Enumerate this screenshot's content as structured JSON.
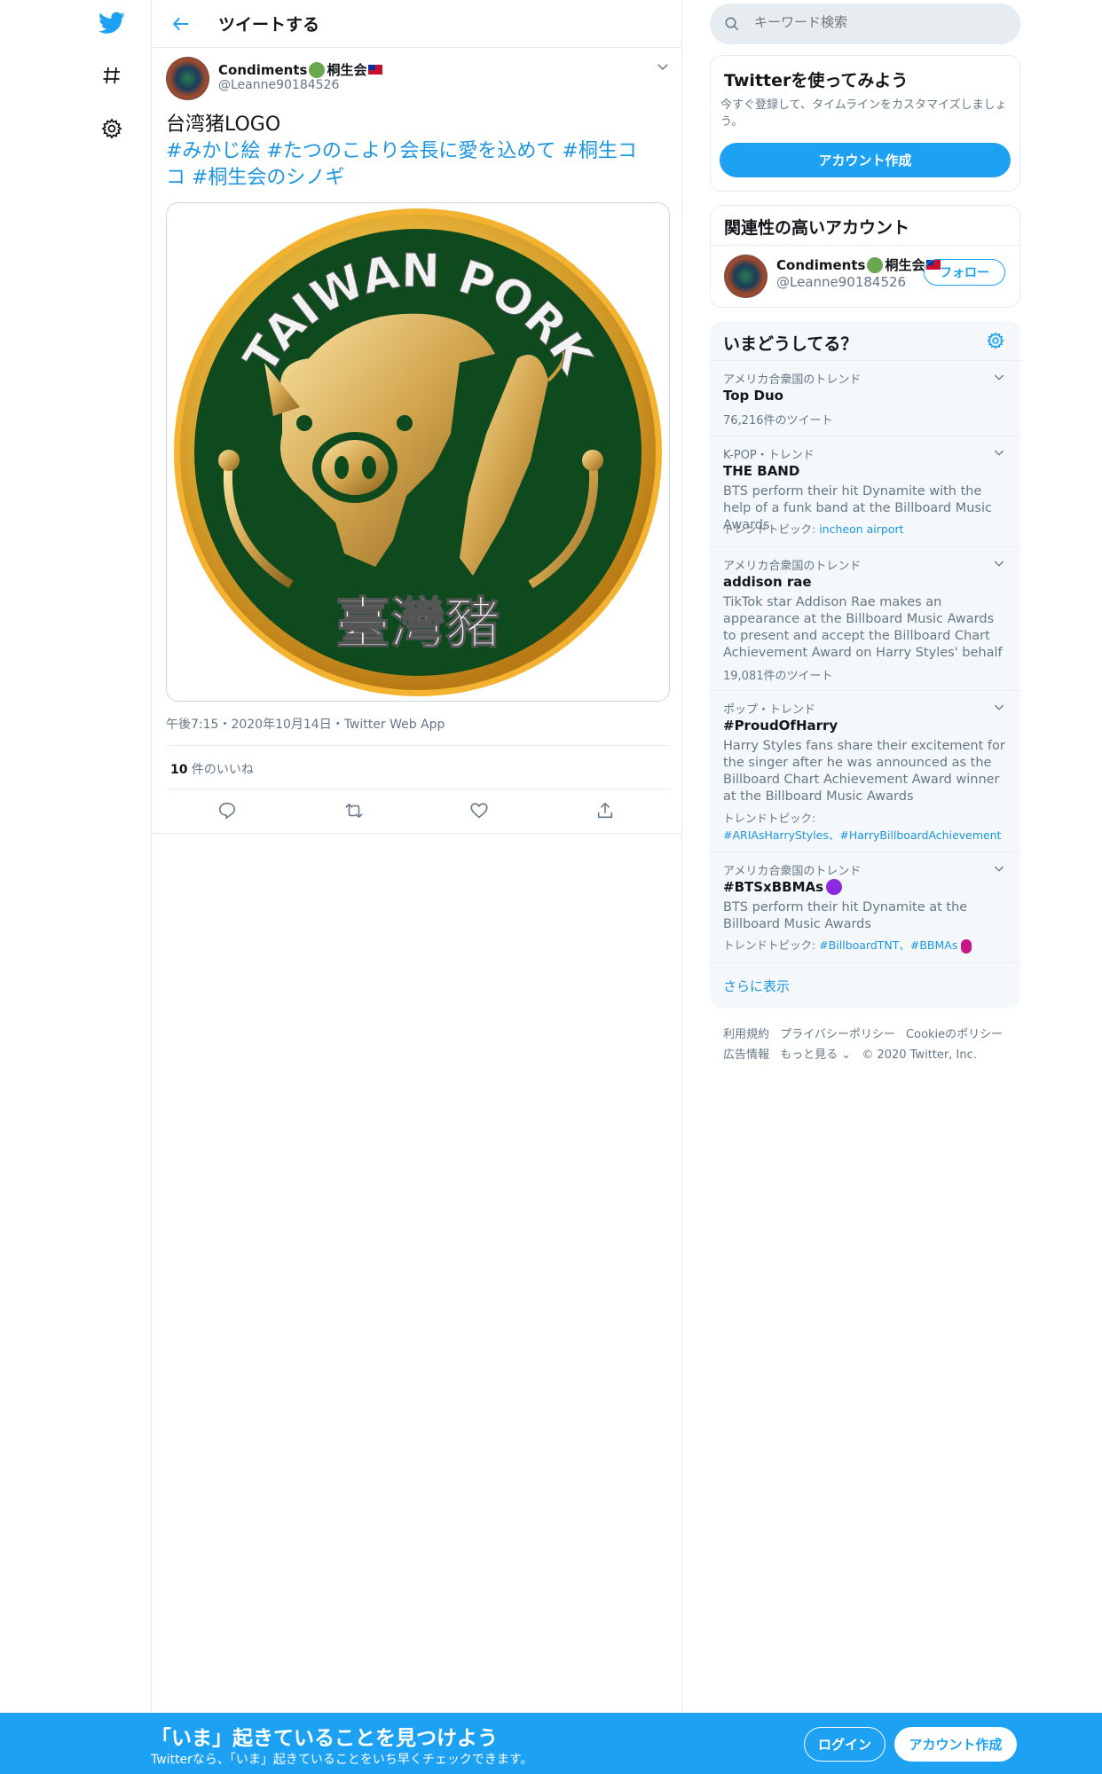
{
  "header": {
    "title": "ツイートする"
  },
  "tweet": {
    "author_name": "Condiments",
    "author_name_suffix": "桐生会",
    "author_handle": "@Leanne90184526",
    "text": "台湾猪LOGO",
    "hashtags_line1": "#みかじ絵 #たつのこより会長に愛を込めて #桐生コ",
    "hashtags_line2": "コ #桐生会のシノギ",
    "image_text_top": "TAIWAN PORK",
    "image_text_bottom": "臺灣豬",
    "meta": "午後7:15・2020年10月14日・Twitter Web App",
    "likes_count": "10",
    "likes_label": " 件のいいね"
  },
  "search": {
    "placeholder": "キーワード検索"
  },
  "signup_card": {
    "title": "Twitterを使ってみよう",
    "desc": "今すぐ登録して、タイムラインをカスタマイズしましょう。",
    "button": "アカウント作成"
  },
  "related": {
    "title": "関連性の高いアカウント",
    "name": "Condiments",
    "name_suffix": "桐生会",
    "handle": "@Leanne90184526",
    "follow": "フォロー"
  },
  "trends": {
    "title": "いまどうしてる？",
    "items": [
      {
        "context": "アメリカ合衆国のトレンド",
        "name": "Top Duo",
        "count": "76,216件のツイート"
      },
      {
        "context": "K-POP・トレンド",
        "name": "THE BAND",
        "desc": "BTS perform their hit Dynamite with the help of a funk band at the Billboard Music Awards",
        "topic_label": "トレンドトピック: ",
        "topic_links": "incheon airport"
      },
      {
        "context": "アメリカ合衆国のトレンド",
        "name": "addison rae",
        "desc": "TikTok star Addison Rae makes an appearance at the Billboard Music Awards to present and accept the Billboard Chart Achievement Award on Harry Styles' behalf",
        "count": "19,081件のツイート"
      },
      {
        "context": "ポップ・トレンド",
        "name": "#ProudOfHarry",
        "desc": "Harry Styles fans share their excitement for the singer after he was announced as the Billboard Chart Achievement Award winner at the Billboard Music Awards",
        "topic_label": "トレンドトピック:",
        "topic_links": "#ARIAsHarryStyles、#HarryBillboardAchievement"
      },
      {
        "context": "アメリカ合衆国のトレンド",
        "name": "#BTSxBBMAs",
        "desc": "BTS perform their hit Dynamite at the Billboard Music Awards",
        "topic_label": "トレンドトピック: ",
        "topic_links": "#BillboardTNT、#BBMAs"
      }
    ],
    "show_more": "さらに表示"
  },
  "footer": {
    "links": [
      "利用規約",
      "プライバシーポリシー",
      "Cookieのポリシー",
      "広告情報",
      "もっと見る ⌄",
      "© 2020 Twitter, Inc."
    ]
  },
  "bottombar": {
    "title": "「いま」起きていることを見つけよう",
    "subtitle": "Twitterなら、「いま」起きていることをいち早くチェックできます。",
    "login": "ログイン",
    "signup": "アカウント作成"
  },
  "colors": {
    "accent": "#1da1f2",
    "link": "#1b95e0",
    "border": "#e6ecf0",
    "muted": "#657786"
  }
}
